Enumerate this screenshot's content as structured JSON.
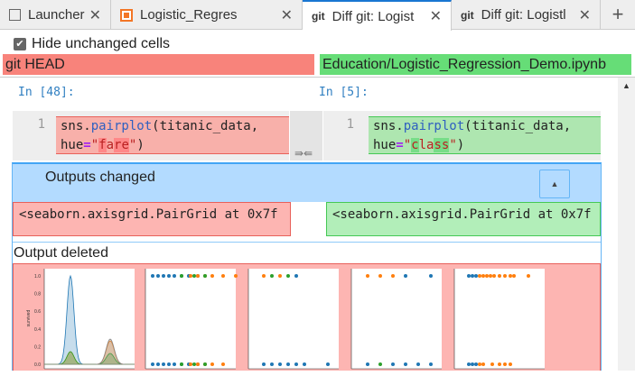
{
  "tabs": [
    {
      "icon": "launcher-icon",
      "label": "Launcher"
    },
    {
      "icon": "notebook-icon",
      "label": "Logistic_Regres"
    },
    {
      "icon": "git-icon",
      "icon_text": "git",
      "label": "Diff git: Logist",
      "active": true
    },
    {
      "icon": "git-icon",
      "icon_text": "git",
      "label": "Diff git: Logistl"
    }
  ],
  "new_tab": "+",
  "close": "✕",
  "hide_unchanged": {
    "label": "Hide unchanged cells",
    "checked": true
  },
  "left_header": "git HEAD",
  "right_header": "Education/Logistic_Regression_Demo.ipynb",
  "left_prompt": "In [48]:",
  "right_prompt": "In [5]:",
  "left_code": {
    "line": "1",
    "a": "sns.",
    "fn": "pairplot",
    "b": "(titanic_data,",
    "c": "hue",
    "eq": "=",
    "q1": "\"",
    "hl1": "f",
    "mid": "a",
    "hl2": "re",
    "q2": "\"",
    ")": ")"
  },
  "right_code": {
    "line": "1",
    "a": "sns.",
    "fn": "pairplot",
    "b": "(titanic_data,",
    "c": "hue",
    "eq": "=",
    "q1": "\"",
    "hl1": "c",
    "mid": "la",
    "hl2": "ss",
    "q2": "\"",
    ")": ")"
  },
  "merge_arrows": "⇛⇚",
  "outputs_changed": "Outputs changed",
  "collapse_icon": "▲",
  "left_output": "<seaborn.axisgrid.PairGrid at 0x7f",
  "right_output": "<seaborn.axisgrid.PairGrid at 0x7f",
  "output_deleted": "Output deleted",
  "plot": {
    "ylabel": "survived",
    "yticks": [
      "1.0",
      "0.8",
      "0.6",
      "0.4",
      "0.2",
      "0.0"
    ],
    "colors": {
      "blue": "#1f77b4",
      "orange": "#ff7f0e",
      "green": "#2ca02c"
    }
  },
  "colors": {
    "deleted": "#f8837b",
    "added": "#66dd77",
    "blue_band": "#b3dbff"
  }
}
